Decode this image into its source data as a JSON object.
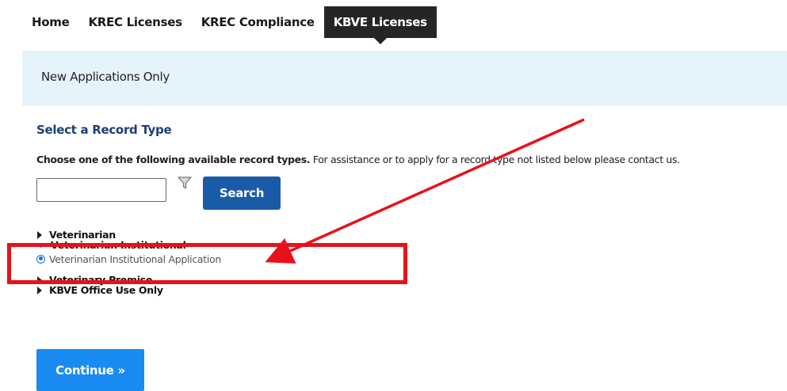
{
  "nav": {
    "tabs": [
      {
        "label": "Home",
        "active": false
      },
      {
        "label": "KREC Licenses",
        "active": false
      },
      {
        "label": "KREC Compliance",
        "active": false
      },
      {
        "label": "KBVE Licenses",
        "active": true
      }
    ]
  },
  "banner": {
    "text": "New Applications Only"
  },
  "section": {
    "title": "Select a Record Type",
    "instructions_bold": "Choose one of the following available record types.",
    "instructions_rest": " For assistance or to apply for a record type not listed below please contact us."
  },
  "search": {
    "value": "",
    "placeholder": "",
    "button_label": "Search",
    "filter_icon": "filter-icon"
  },
  "tree": {
    "items": [
      {
        "label": "Veterinarian",
        "expanded": false
      },
      {
        "label": "Veterinarian Institutional",
        "expanded": true,
        "options": [
          {
            "label": "Veterinarian Institutional Application",
            "selected": true
          }
        ]
      },
      {
        "label": "Veterinary Premise",
        "expanded": false
      },
      {
        "label": "KBVE Office Use Only",
        "expanded": false
      }
    ]
  },
  "continue_button": {
    "label": "Continue »"
  },
  "annotation": {
    "highlight_color": "#e8111b",
    "arrow_color": "#e8111b"
  },
  "colors": {
    "nav_active_bg": "#252525",
    "banner_bg": "#e5f3fb",
    "title": "#1d3f72",
    "search_btn": "#1a5ba8",
    "continue_btn": "#1a8bf0",
    "radio": "#1a73e8"
  }
}
